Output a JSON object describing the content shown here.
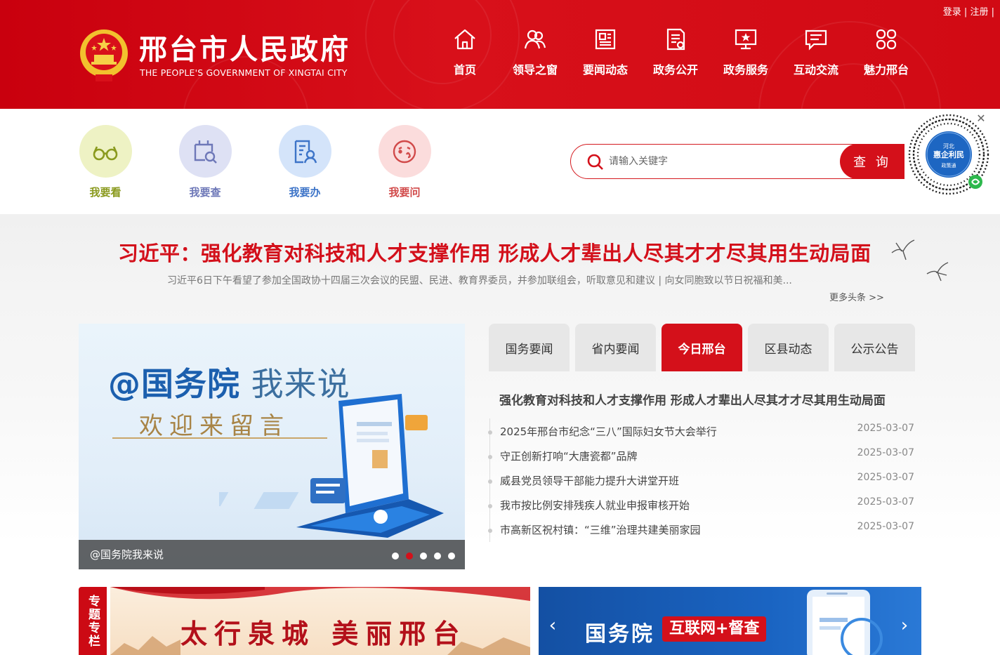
{
  "topbar": {
    "login": "登录",
    "sep1": "|",
    "register": "注册",
    "sep2": "|"
  },
  "header": {
    "title": "邢台市人民政府",
    "subtitle": "THE PEOPLE'S GOVERNMENT OF XINGTAI CITY",
    "nav": [
      {
        "label": "首页",
        "icon": "home-icon"
      },
      {
        "label": "领导之窗",
        "icon": "leaders-icon"
      },
      {
        "label": "要闻动态",
        "icon": "news-icon"
      },
      {
        "label": "政务公开",
        "icon": "document-icon"
      },
      {
        "label": "政务服务",
        "icon": "service-icon"
      },
      {
        "label": "互动交流",
        "icon": "chat-icon"
      },
      {
        "label": "魅力邢台",
        "icon": "grid-icon"
      }
    ]
  },
  "quick": [
    {
      "label": "我要看",
      "color": "#8a9a1e",
      "bg": "#eef2c4",
      "icon": "glasses-icon"
    },
    {
      "label": "我要查",
      "color": "#6e78b8",
      "bg": "#dee1f4",
      "icon": "search-doc-icon"
    },
    {
      "label": "我要办",
      "color": "#3d74c8",
      "bg": "#d4e4fa",
      "icon": "apply-icon"
    },
    {
      "label": "我要问",
      "color": "#d14a4a",
      "bg": "#fbdcdc",
      "icon": "ask-icon"
    }
  ],
  "search": {
    "placeholder": "请输入关键字",
    "button": "查 询"
  },
  "qr": {
    "line1": "河北",
    "line2": "惠企利民",
    "line3": "政策通"
  },
  "headline": {
    "title": "习近平：强化教育对科技和人才支撑作用 形成人才辈出人尽其才才尽其用生动局面",
    "summary": "习近平6日下午看望了参加全国政协十四届三次会议的民盟、民进、教育界委员，并参加联组会，听取意见和建议 | 向女同胞致以节日祝福和美...",
    "more": "更多头条 >>"
  },
  "carousel": {
    "title_a": "@国务院",
    "title_b": " 我来说",
    "subtitle": "欢迎来留言",
    "caption": "@国务院我来说",
    "dots": 5,
    "active_dot": 1
  },
  "news": {
    "tabs": [
      "国务要闻",
      "省内要闻",
      "今日邢台",
      "区县动态",
      "公示公告"
    ],
    "active_tab": 2,
    "top": "强化教育对科技和人才支撑作用 形成人才辈出人尽其才才尽其用生动局面",
    "items": [
      {
        "title": "2025年邢台市纪念“三八”国际妇女节大会举行",
        "date": "2025-03-07"
      },
      {
        "title": "守正创新打响“大唐瓷都”品牌",
        "date": "2025-03-07"
      },
      {
        "title": "威县党员领导干部能力提升大讲堂开班",
        "date": "2025-03-07"
      },
      {
        "title": "我市按比例安排残疾人就业申报审核开始",
        "date": "2025-03-07"
      },
      {
        "title": "市高新区祝村镇：“三维”治理共建美丽家园",
        "date": "2025-03-07"
      }
    ]
  },
  "special": {
    "tag": "专题专栏",
    "banner1": "太行泉城 美丽邢台",
    "banner2_a": "国务院",
    "banner2_b": "互联网+督查",
    "prev": "‹",
    "next": "›"
  },
  "colors": {
    "brand_red": "#d4101a",
    "header_red": "#c9000e",
    "link_gray": "#444444"
  }
}
